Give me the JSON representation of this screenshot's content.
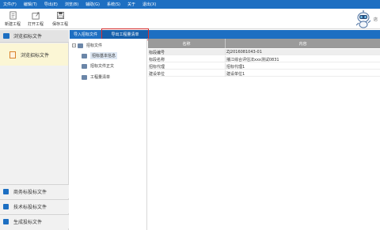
{
  "menubar": {
    "items": [
      "文件(F)",
      "编辑(T)",
      "导出(E)",
      "浏览(B)",
      "辅助(G)",
      "系统(S)",
      "关于",
      "退出(X)"
    ]
  },
  "toolbar": {
    "buttons": [
      {
        "label": "新建工程",
        "icon": "new-project-icon"
      },
      {
        "label": "打开工程",
        "icon": "open-project-icon"
      },
      {
        "label": "保存工程",
        "icon": "save-project-icon"
      }
    ]
  },
  "assistant": {
    "text": "店"
  },
  "sidebar": {
    "header": "浏览招标文件",
    "sub_item": "浏览招标文件",
    "sections": [
      "商务标投标文件",
      "技术标投标文件",
      "生成投标文件"
    ]
  },
  "tabs": [
    {
      "label": "导入招标文件",
      "active": false
    },
    {
      "label": "导出工程量清单",
      "active": true
    }
  ],
  "tree": {
    "root": "招标文件",
    "children": [
      "招标基本信息",
      "招标文件正文",
      "工程量清单"
    ],
    "selected_index": 0
  },
  "table": {
    "headers": [
      "名称",
      "内容"
    ],
    "rows": [
      {
        "name": "标段编号",
        "value": "ZJ2016081043-01"
      },
      {
        "name": "标段名称",
        "value": "播江综合评估法xxx测试0831"
      },
      {
        "name": "招标代理",
        "value": "招标代理1"
      },
      {
        "name": "建设单位",
        "value": "建设单位1"
      }
    ]
  },
  "colors": {
    "menubar": "#1d6fc2",
    "highlight_border": "#d62c2c",
    "selected_row": "#fbf6d5"
  }
}
